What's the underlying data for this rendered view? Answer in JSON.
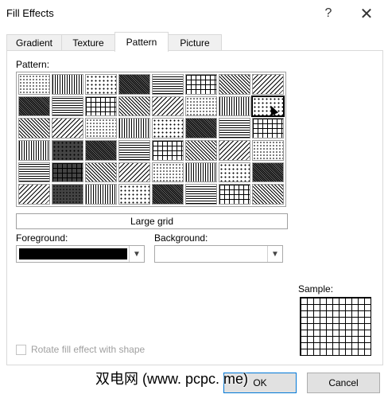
{
  "window": {
    "title": "Fill Effects",
    "help_glyph": "?",
    "close_glyph": "✕"
  },
  "tabs": [
    {
      "label": "Gradient",
      "active": false
    },
    {
      "label": "Texture",
      "active": false
    },
    {
      "label": "Pattern",
      "active": true
    },
    {
      "label": "Picture",
      "active": false
    }
  ],
  "pattern": {
    "label": "Pattern:",
    "selected_name": "Large grid",
    "cells": [
      "d1",
      "dense",
      "dg",
      "v",
      "hwave",
      "zig",
      "dots2",
      "grid",
      "d2",
      "dark",
      "d45",
      "brick_h",
      "d_w",
      "wave2",
      "gridS",
      "gridL",
      "d3",
      "dark2",
      "d45b",
      "dashH",
      "zzH",
      "diam",
      "dotsG",
      "check",
      "d4",
      "dark3",
      "d45c",
      "hlines",
      "dsh",
      "brick",
      "weave",
      "checkL",
      "vdots",
      "black",
      "diag",
      "vert",
      "sm",
      "pebble",
      "hatch",
      "plaid",
      "dk",
      "dots_b",
      "diagW",
      "vertW",
      "conf",
      "trellis",
      "sphere",
      "diamL"
    ]
  },
  "foreground": {
    "label": "Foreground:",
    "color": "#000000"
  },
  "background": {
    "label": "Background:",
    "color": "#ffffff"
  },
  "sample": {
    "label": "Sample:"
  },
  "rotate_checkbox": {
    "label": "Rotate fill effect with shape",
    "checked": false,
    "enabled": false
  },
  "buttons": {
    "ok": "OK",
    "cancel": "Cancel"
  },
  "watermark": "双电网 (www. pcpc. me)"
}
